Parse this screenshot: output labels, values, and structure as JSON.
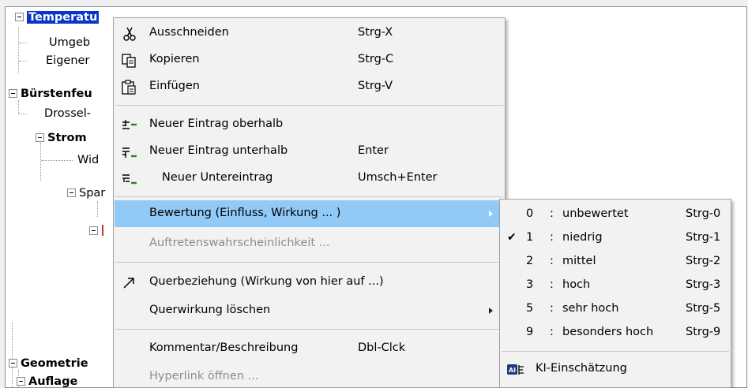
{
  "tree": {
    "items": [
      {
        "label": "Temperatu",
        "bold": true,
        "selected": true
      },
      {
        "label": "Umgeb"
      },
      {
        "label": "Eigener"
      },
      {
        "label": "Bürstenfeu",
        "bold": true
      },
      {
        "label": "Drossel-"
      },
      {
        "label": "Strom",
        "bold": true
      },
      {
        "label": "Wid"
      },
      {
        "label": "Spar"
      },
      {
        "label": "Geometrie",
        "bold": true
      },
      {
        "label": "Auflage",
        "bold": true
      }
    ]
  },
  "menu": {
    "items": [
      {
        "label": "Ausschneiden",
        "shortcut": "Strg-X",
        "icon": "scissors-icon"
      },
      {
        "label": "Kopieren",
        "shortcut": "Strg-C",
        "icon": "copy-icon"
      },
      {
        "label": "Einfügen",
        "shortcut": "Strg-V",
        "icon": "paste-icon"
      },
      {
        "label": "Neuer Eintrag oberhalb",
        "shortcut": "",
        "icon": "insert-above-icon"
      },
      {
        "label": "Neuer Eintrag unterhalb",
        "shortcut": "Enter",
        "icon": "insert-below-icon"
      },
      {
        "label": "Neuer Untereintrag",
        "shortcut": "Umsch+Enter",
        "icon": "insert-child-icon"
      },
      {
        "label": "Bewertung (Einfluss, Wirkung ... )",
        "shortcut": "",
        "highlighted": true,
        "submenu": true
      },
      {
        "label": "Auftretenswahrscheinlichkeit ...",
        "shortcut": "",
        "disabled": true
      },
      {
        "label": "Querbeziehung (Wirkung von hier auf ...)",
        "shortcut": "",
        "icon": "arrow-diagonal-icon"
      },
      {
        "label": "Querwirkung löschen",
        "shortcut": "",
        "submenu": true
      },
      {
        "label": "Kommentar/Beschreibung",
        "shortcut": "Dbl-Clck"
      },
      {
        "label": "Hyperlink öffnen ...",
        "shortcut": "",
        "disabled": true
      }
    ]
  },
  "submenu": {
    "items": [
      {
        "num": "0",
        "label": "unbewertet",
        "shortcut": "Strg-0",
        "checked": false
      },
      {
        "num": "1",
        "label": "niedrig",
        "shortcut": "Strg-1",
        "checked": true
      },
      {
        "num": "2",
        "label": "mittel",
        "shortcut": "Strg-2",
        "checked": false
      },
      {
        "num": "3",
        "label": "hoch",
        "shortcut": "Strg-3",
        "checked": false
      },
      {
        "num": "5",
        "label": "sehr hoch",
        "shortcut": "Strg-5",
        "checked": false
      },
      {
        "num": "9",
        "label": "besonders hoch",
        "shortcut": "Strg-9",
        "checked": false
      }
    ],
    "colon": ":",
    "check_mark": "✔",
    "ki": {
      "label": "KI-Einschätzung",
      "icon": "ai-icon"
    }
  },
  "colors": {
    "highlight": "#91c9f7",
    "selection": "#0a36c8",
    "disabled": "#8d8d8d"
  }
}
